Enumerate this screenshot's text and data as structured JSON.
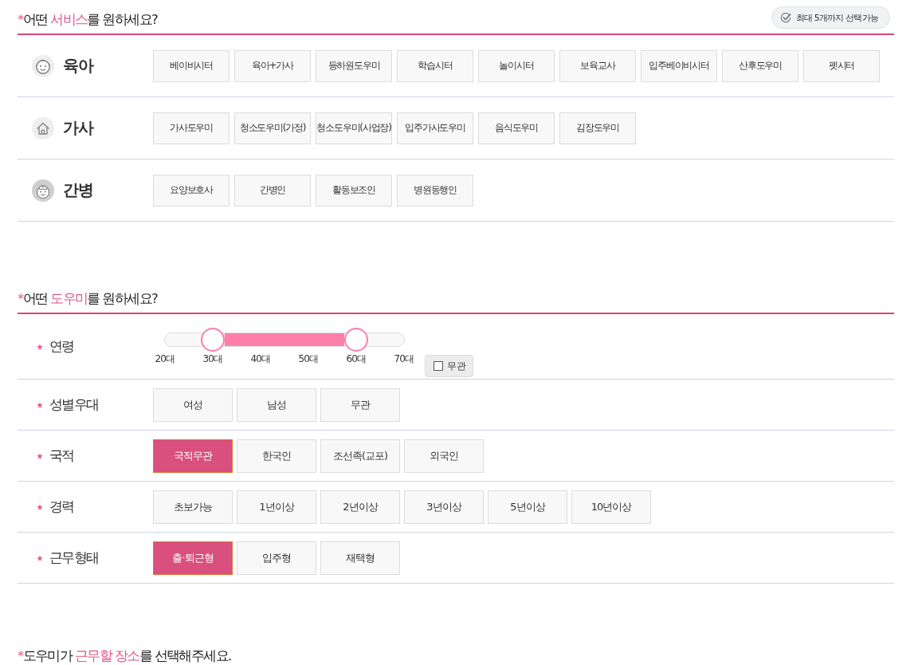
{
  "service_section": {
    "title": [
      {
        "text": "*",
        "highlight": true
      },
      {
        "text": "어떤 ",
        "highlight": false
      },
      {
        "text": "서비스",
        "highlight": true
      },
      {
        "text": "를 원하세요?",
        "highlight": false
      }
    ],
    "limit_badge": {
      "label": "최대 5개까지 선택가능"
    },
    "categories": [
      {
        "kind": "childcare",
        "label": "육아",
        "options": [
          {
            "label": "베이비시터",
            "selected": false
          },
          {
            "label": "육아+가사",
            "selected": false
          },
          {
            "label": "등하원도우미",
            "selected": false
          },
          {
            "label": "학습시터",
            "selected": false
          },
          {
            "label": "놀이시터",
            "selected": false
          },
          {
            "label": "보육교사",
            "selected": false
          },
          {
            "label": "입주베이비시터",
            "selected": false
          },
          {
            "label": "산후도우미",
            "selected": false
          },
          {
            "label": "펫시터",
            "selected": false
          }
        ]
      },
      {
        "kind": "housework",
        "label": "가사",
        "options": [
          {
            "label": "가사도우미",
            "selected": false
          },
          {
            "label": "청소도우미(가정)",
            "selected": false
          },
          {
            "label": "청소도우미(사업장)",
            "selected": false
          },
          {
            "label": "입주가사도우미",
            "selected": false
          },
          {
            "label": "음식도우미",
            "selected": false
          },
          {
            "label": "김장도우미",
            "selected": false
          }
        ]
      },
      {
        "kind": "nursing",
        "label": "간병",
        "options": [
          {
            "label": "요양보호사",
            "selected": false
          },
          {
            "label": "간병인",
            "selected": false
          },
          {
            "label": "활동보조인",
            "selected": false
          },
          {
            "label": "병원동행인",
            "selected": false
          }
        ]
      }
    ]
  },
  "helper_section": {
    "title": [
      {
        "text": "*",
        "highlight": true
      },
      {
        "text": "어떤 ",
        "highlight": false
      },
      {
        "text": "도우미",
        "highlight": true
      },
      {
        "text": "를 원하세요?",
        "highlight": false
      }
    ],
    "criteria": [
      {
        "kind": "range",
        "required": true,
        "label": "연령",
        "thumbs": [
          {
            "level": 0.2
          },
          {
            "level": 0.8
          }
        ],
        "ticks": [
          "20대",
          "30대",
          "40대",
          "50대",
          "60대",
          "70대"
        ],
        "any_option": {
          "label": "무관",
          "checked": false
        }
      },
      {
        "kind": "choice",
        "required": true,
        "label": "성별우대",
        "options": [
          {
            "label": "여성",
            "selected": false
          },
          {
            "label": "남성",
            "selected": false
          },
          {
            "label": "무관",
            "selected": false
          }
        ]
      },
      {
        "kind": "choice",
        "required": true,
        "label": "국적",
        "options": [
          {
            "label": "국적무관",
            "selected": true
          },
          {
            "label": "한국인",
            "selected": false
          },
          {
            "label": "조선족(교포)",
            "selected": false
          },
          {
            "label": "외국인",
            "selected": false
          }
        ]
      },
      {
        "kind": "choice",
        "required": true,
        "label": "경력",
        "options": [
          {
            "label": "초보가능",
            "selected": false
          },
          {
            "label": "1년이상",
            "selected": false
          },
          {
            "label": "2년이상",
            "selected": false
          },
          {
            "label": "3년이상",
            "selected": false
          },
          {
            "label": "5년이상",
            "selected": false
          },
          {
            "label": "10년이상",
            "selected": false
          }
        ]
      },
      {
        "kind": "choice",
        "required": true,
        "label": "근무형태",
        "options": [
          {
            "label": "출·퇴근형",
            "selected": true
          },
          {
            "label": "입주형",
            "selected": false
          },
          {
            "label": "재택형",
            "selected": false
          }
        ]
      }
    ]
  },
  "location_section": {
    "title": [
      {
        "text": "*",
        "highlight": true
      },
      {
        "text": "도우미가 ",
        "highlight": false
      },
      {
        "text": "근무할 장소",
        "highlight": true
      },
      {
        "text": "를 선택해주세요.",
        "highlight": false
      }
    ]
  }
}
